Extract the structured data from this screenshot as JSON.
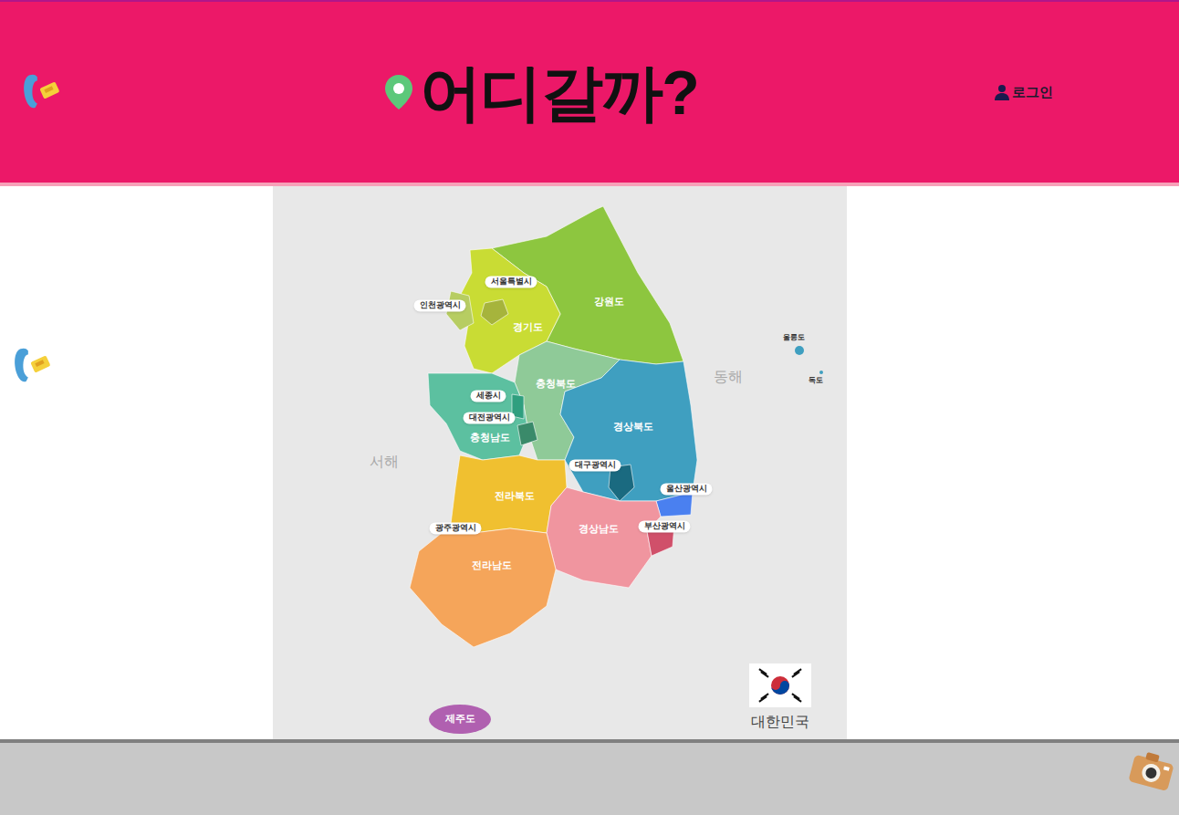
{
  "header": {
    "title": "어디갈까?",
    "login": "로그인"
  },
  "map": {
    "regions": [
      {
        "name": "강원도",
        "kind": "area",
        "color": "#8dc63f"
      },
      {
        "name": "경기도",
        "kind": "area",
        "color": "#c9dc34"
      },
      {
        "name": "서울특별시",
        "kind": "pill",
        "color": "#a6b43c"
      },
      {
        "name": "인천광역시",
        "kind": "pill",
        "color": "#b7cd62"
      },
      {
        "name": "충청북도",
        "kind": "area",
        "color": "#8fca98"
      },
      {
        "name": "충청남도",
        "kind": "area",
        "color": "#5cc0a0"
      },
      {
        "name": "세종시",
        "kind": "pill",
        "color": "#2f9f7f"
      },
      {
        "name": "대전광역시",
        "kind": "pill",
        "color": "#3a8a6a"
      },
      {
        "name": "경상북도",
        "kind": "area",
        "color": "#3f9fc0"
      },
      {
        "name": "대구광역시",
        "kind": "pill",
        "color": "#1a6a80"
      },
      {
        "name": "울산광역시",
        "kind": "pill",
        "color": "#4a80f0"
      },
      {
        "name": "전라북도",
        "kind": "area",
        "color": "#f0c030"
      },
      {
        "name": "경상남도",
        "kind": "area",
        "color": "#f0959f"
      },
      {
        "name": "부산광역시",
        "kind": "pill",
        "color": "#d0506a"
      },
      {
        "name": "광주광역시",
        "kind": "pill",
        "color": "#d08050"
      },
      {
        "name": "전라남도",
        "kind": "area",
        "color": "#f5a55a"
      },
      {
        "name": "제주도",
        "kind": "area",
        "color": "#b060b0"
      },
      {
        "name": "울릉도",
        "kind": "island",
        "color": "#3f9fc0"
      },
      {
        "name": "독도",
        "kind": "island",
        "color": "#3f9fc0"
      }
    ],
    "seas": [
      "동해",
      "서해"
    ],
    "country": "대한민국"
  }
}
